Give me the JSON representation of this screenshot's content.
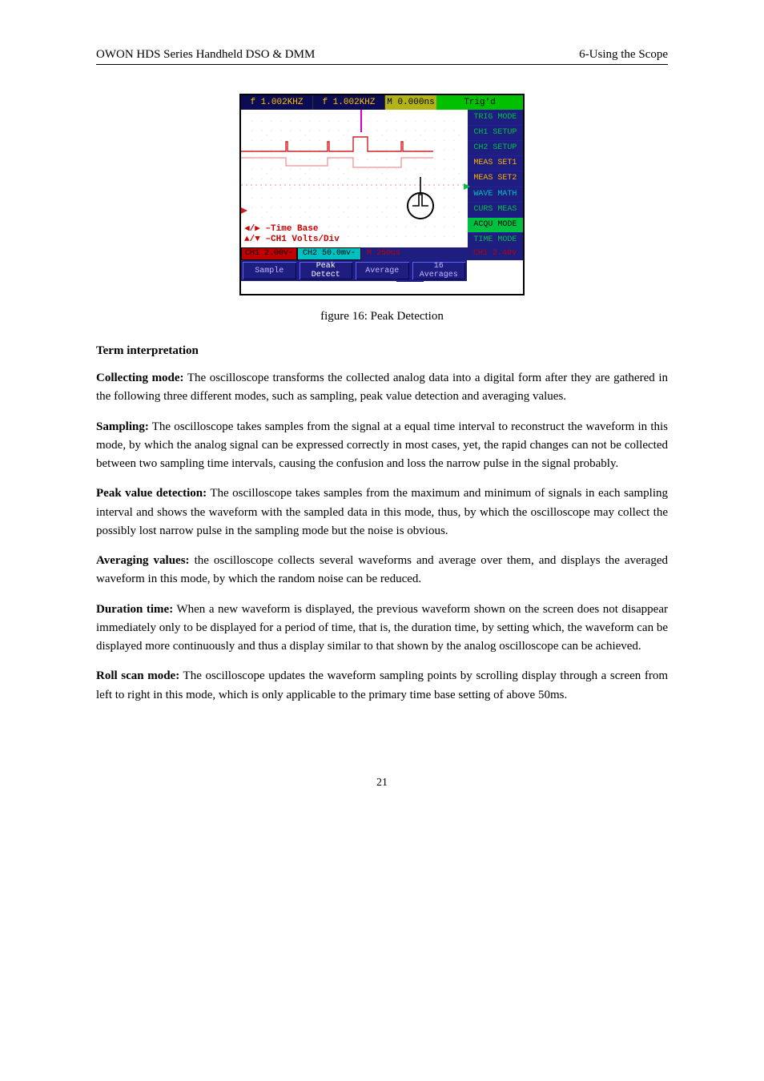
{
  "header": {
    "left": "OWON   HDS Series Handheld DSO & DMM",
    "right": "6-Using the Scope"
  },
  "scope": {
    "freq1": "f 1.002KHZ",
    "freq2": "f 1.002KHZ",
    "mtime": "M 0.000ns",
    "trig": "Trig'd",
    "menu": {
      "m1": "TRIG MODE",
      "m2": "CH1 SETUP",
      "m3": "CH2 SETUP",
      "m4": "MEAS SET1",
      "m5": "MEAS SET2",
      "m6": "WAVE MATH",
      "m7": "CURS MEAS",
      "m8": "ACQU MODE",
      "m9": "TIME MODE"
    },
    "hint1": "◀/▶ –Time Base",
    "hint2": "▲/▼ –CH1 Volts/Div",
    "status": {
      "ch1": "CH1 2.00v-",
      "ch2": "CH2 50.0mv-",
      "m": "M 250us",
      "trig": "CH1 2.40v"
    },
    "buttons": {
      "b1": "Sample",
      "b2": "Peak\nDetect",
      "b3": "Average",
      "b4": "16\nAverages"
    }
  },
  "caption": "figure 16: Peak Detection",
  "sectionTitle": "Term interpretation",
  "para1": {
    "lead": "Collecting mode:",
    "text": " The oscilloscope transforms the collected analog data into a digital form after they are gathered in the following three different modes, such as sampling, peak value detection and averaging values."
  },
  "para2": {
    "lead": "Sampling:",
    "text": " The oscilloscope takes samples from the signal at a equal time interval to reconstruct the waveform in this mode, by which the analog signal can be expressed correctly in most cases, yet, the rapid changes can not be collected between two sampling time intervals, causing the confusion and loss the narrow pulse in the signal probably."
  },
  "para3": {
    "lead": "Peak value detection:",
    "text": " The oscilloscope takes samples from the maximum and minimum of signals in each sampling interval and shows the waveform with the sampled data in this mode, thus, by which the oscilloscope may collect the possibly lost narrow pulse in the sampling mode but the noise is obvious."
  },
  "para4": {
    "lead": "Averaging values:",
    "text": " the oscilloscope collects several waveforms and average over them, and displays the averaged waveform in this mode, by which the random noise can be reduced."
  },
  "para5": {
    "lead": "Duration time:",
    "text": " When a new waveform is displayed, the previous waveform shown on the screen does not disappear immediately only to be displayed for a period of time, that is, the duration time, by setting which, the waveform can be displayed more continuously and thus a display similar to that shown by the analog oscilloscope can be achieved."
  },
  "para6": {
    "lead": "Roll scan mode:",
    "text": " The oscilloscope updates the waveform sampling points by scrolling display through a screen from left to right in this mode, which is only applicable to the primary time base setting of above 50ms."
  },
  "pageNumber": "21"
}
